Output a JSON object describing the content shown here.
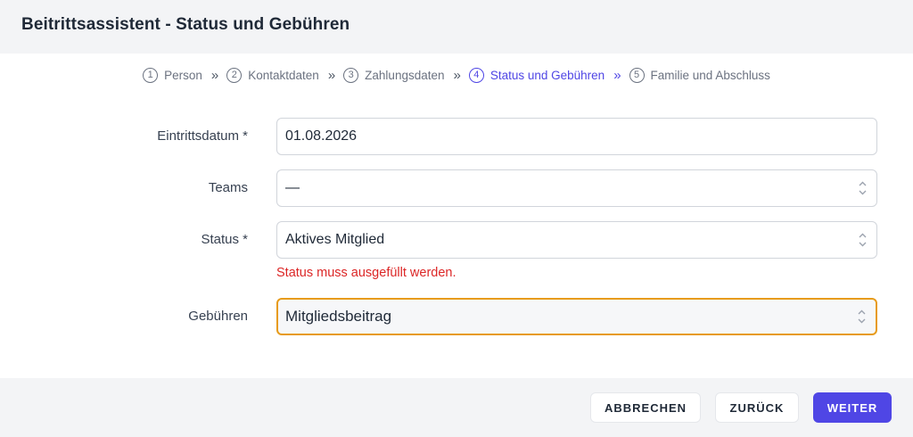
{
  "header": {
    "title": "Beitrittsassistent - Status und Gebühren"
  },
  "steps": [
    {
      "num": "1",
      "label": "Person"
    },
    {
      "num": "2",
      "label": "Kontaktdaten"
    },
    {
      "num": "3",
      "label": "Zahlungsdaten"
    },
    {
      "num": "4",
      "label": "Status und Gebühren",
      "active": true
    },
    {
      "num": "5",
      "label": "Familie und Abschluss"
    }
  ],
  "step_separator": "»",
  "form": {
    "entry_date": {
      "label": "Eintrittsdatum *",
      "value": "01.08.2026"
    },
    "teams": {
      "label": "Teams",
      "value": "—"
    },
    "status": {
      "label": "Status *",
      "value": "Aktives Mitglied",
      "error": "Status muss ausgefüllt werden."
    },
    "fees": {
      "label": "Gebühren",
      "value": "Mitgliedsbeitrag"
    }
  },
  "footer": {
    "cancel_label": "ABBRECHEN",
    "back_label": "ZURÜCK",
    "next_label": "WEITER"
  },
  "colors": {
    "accent": "#4f46e5",
    "error": "#dc2626",
    "focus_border": "#e79b19"
  }
}
